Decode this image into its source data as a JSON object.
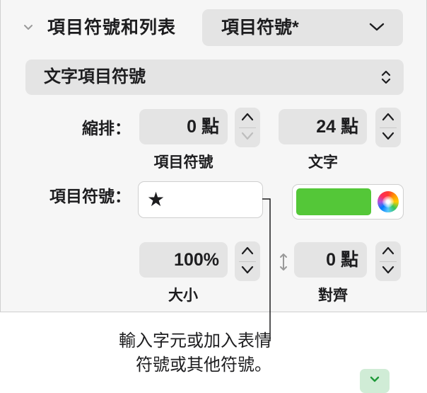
{
  "section": {
    "title": "項目符號和列表"
  },
  "style_popup": {
    "value": "項目符號*"
  },
  "type_popup": {
    "value": "文字項目符號"
  },
  "indent": {
    "label": "縮排：",
    "bullet_value": "0 點",
    "bullet_caption": "項目符號",
    "text_value": "24 點",
    "text_caption": "文字"
  },
  "bullet": {
    "label": "項目符號：",
    "glyph": "★",
    "color_hex": "#54c738"
  },
  "size": {
    "value": "100%",
    "caption": "大小"
  },
  "align": {
    "value": "0 點",
    "caption": "對齊"
  },
  "callout": {
    "line1": "輸入字元或加入表情",
    "line2": "符號或其他符號。"
  }
}
